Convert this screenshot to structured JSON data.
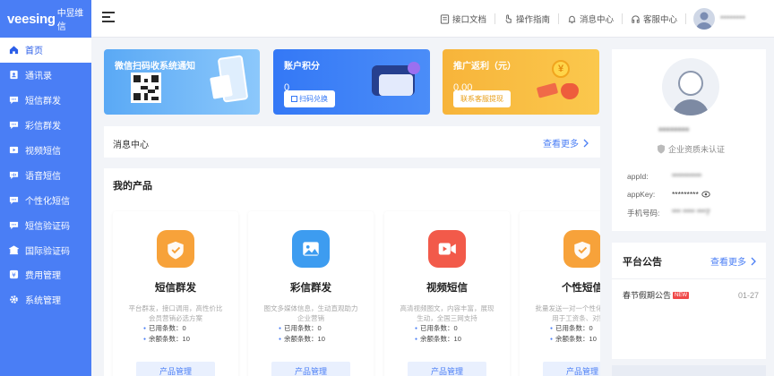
{
  "brand": {
    "logo": "veesing",
    "logo_cn": "中昱维信"
  },
  "sidebar": {
    "items": [
      {
        "label": "首页",
        "icon": "home-icon"
      },
      {
        "label": "通讯录",
        "icon": "contacts-icon"
      },
      {
        "label": "短信群发",
        "icon": "chat-icon"
      },
      {
        "label": "彩信群发",
        "icon": "chat-icon"
      },
      {
        "label": "视频短信",
        "icon": "video-icon"
      },
      {
        "label": "语音短信",
        "icon": "voice-icon"
      },
      {
        "label": "个性化短信",
        "icon": "chat-icon"
      },
      {
        "label": "短信验证码",
        "icon": "chat-icon"
      },
      {
        "label": "国际验证码",
        "icon": "building-icon"
      },
      {
        "label": "费用管理",
        "icon": "yen-icon"
      },
      {
        "label": "系统管理",
        "icon": "gear-icon"
      }
    ]
  },
  "header": {
    "links": [
      "接口文档",
      "操作指南",
      "消息中心",
      "客服中心"
    ],
    "username": "********"
  },
  "banners": {
    "wechat": {
      "title": "微信扫码收系统通知"
    },
    "points": {
      "title": "账户积分",
      "value": "0",
      "button": "扫码兑换"
    },
    "rebate": {
      "title": "推广返利（元）",
      "value": "0.00",
      "button": "联系客服提现"
    }
  },
  "messages": {
    "title": "消息中心",
    "more": "查看更多"
  },
  "products": {
    "title": "我的产品",
    "items": [
      {
        "name": "短信群发",
        "desc": "平台群发，接口调用，高性价比会员营销必选方案",
        "used_label": "已用条数：",
        "used": "0",
        "remain_label": "余额条数：",
        "remain": "10",
        "button": "产品管理",
        "color": "#f7a23a"
      },
      {
        "name": "彩信群发",
        "desc": "图文多媒体信息，生动直观助力企业营销",
        "used_label": "已用条数：",
        "used": "0",
        "remain_label": "余额条数：",
        "remain": "10",
        "button": "产品管理",
        "color": "#3d9cf0"
      },
      {
        "name": "视频短信",
        "desc": "高清视频图文，内容丰富，展现生动，全国三网支持",
        "used_label": "已用条数：",
        "used": "0",
        "remain_label": "余额条数：",
        "remain": "10",
        "button": "产品管理",
        "color": "#f25a4a"
      },
      {
        "name": "个性短信",
        "desc": "批量发送一对一个性化内容，适用于工资条、对账单",
        "used_label": "已用条数：",
        "used": "0",
        "remain_label": "余额条数：",
        "remain": "10",
        "button": "产品管理",
        "color": "#f7a23a"
      }
    ]
  },
  "profile": {
    "name": "********",
    "cert": "企业资质未认证",
    "appid_label": "appId:",
    "appid": "**********",
    "appkey_label": "appKey:",
    "appkey": "*********",
    "phone_label": "手机号码:",
    "phone": "*** **** ***7"
  },
  "announcements": {
    "title": "平台公告",
    "more": "查看更多",
    "items": [
      {
        "text": "春节假期公告",
        "badge": "NEW",
        "date": "01-27"
      }
    ]
  }
}
